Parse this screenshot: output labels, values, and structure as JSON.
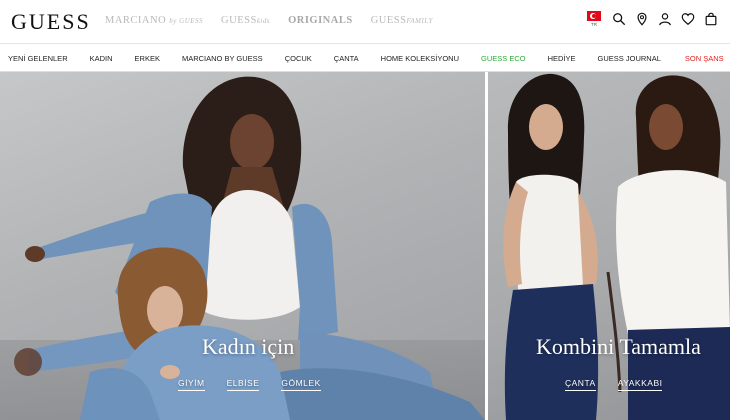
{
  "header": {
    "logo": "GUESS",
    "brands": [
      {
        "main": "MARCIANO",
        "sub": "by GUESS"
      },
      {
        "main": "GUESS",
        "sub": "kids"
      },
      {
        "main": "ORIGINALS",
        "sub": ""
      },
      {
        "main": "GUESS",
        "sub": "FAMILY"
      }
    ],
    "country_code": "TR",
    "icons": [
      "flag-icon",
      "search-icon",
      "location-icon",
      "account-icon",
      "wishlist-icon",
      "bag-icon"
    ]
  },
  "nav": {
    "items": [
      "YENİ GELENLER",
      "KADIN",
      "ERKEK",
      "MARCIANO BY GUESS",
      "ÇOCUK",
      "ÇANTA",
      "HOME KOLEKSİYONU",
      "GUESS ECO",
      "HEDİYE",
      "GUESS JOURNAL",
      "SON ŞANS"
    ],
    "eco_color": "#2eaa3a",
    "sale_color": "#e32222"
  },
  "hero_left": {
    "title": "Kadın için",
    "links": [
      "GİYİM",
      "ELBİSE",
      "GÖMLEK"
    ]
  },
  "hero_right": {
    "title": "Kombini Tamamla",
    "links": [
      "ÇANTA",
      "AYAKKABI"
    ]
  }
}
